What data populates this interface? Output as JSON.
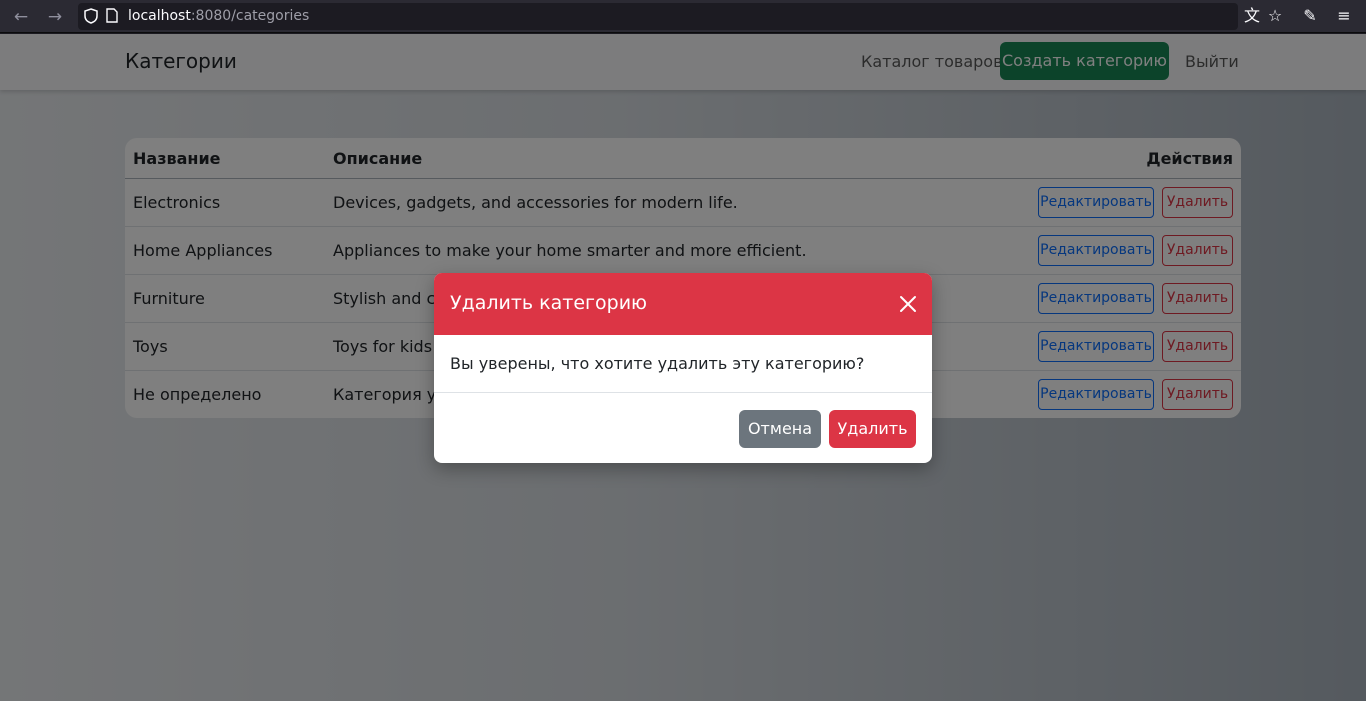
{
  "browser": {
    "url_host": "localhost",
    "url_rest": ":8080/categories"
  },
  "navbar": {
    "brand": "Категории",
    "catalog_link": "Каталог товаров",
    "create_button": "Создать категорию",
    "logout_link": "Выйти"
  },
  "table": {
    "headers": {
      "name": "Название",
      "description": "Описание",
      "actions": "Действия"
    },
    "rows": [
      {
        "name": "Electronics",
        "description": "Devices, gadgets, and accessories for modern life.",
        "edit": "Редактировать",
        "delete": "Удалить"
      },
      {
        "name": "Home Appliances",
        "description": "Appliances to make your home smarter and more efficient.",
        "edit": "Редактировать",
        "delete": "Удалить"
      },
      {
        "name": "Furniture",
        "description": "Stylish and co",
        "edit": "Редактировать",
        "delete": "Удалить"
      },
      {
        "name": "Toys",
        "description": "Toys for kids o",
        "edit": "Редактировать",
        "delete": "Удалить"
      },
      {
        "name": "Не определено",
        "description": "Категория уда",
        "edit": "Редактировать",
        "delete": "Удалить"
      }
    ]
  },
  "modal": {
    "title": "Удалить категорию",
    "message": "Вы уверены, что хотите удалить эту категорию?",
    "cancel_button": "Отмена",
    "confirm_button": "Удалить"
  },
  "colors": {
    "success": "#198754",
    "danger": "#dc3545",
    "primary": "#0d6efd",
    "secondary": "#6c757d"
  }
}
